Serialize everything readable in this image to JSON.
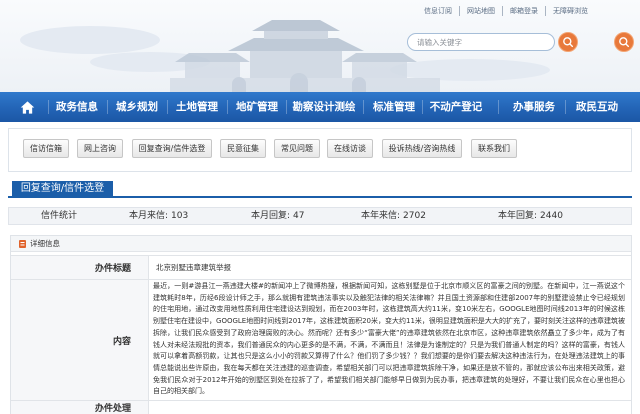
{
  "top_links": [
    {
      "label": "信息订阅"
    },
    {
      "label": "网站地图"
    },
    {
      "label": "邮箱登录"
    },
    {
      "label": "无障碍浏览"
    }
  ],
  "search": {
    "placeholder": "请输入关键字"
  },
  "nav": {
    "items": [
      {
        "label": "政务信息"
      },
      {
        "label": "城乡规划"
      },
      {
        "label": "土地管理"
      },
      {
        "label": "地矿管理"
      },
      {
        "label": "勘察设计测绘"
      },
      {
        "label": "标准管理"
      },
      {
        "label": "不动产登记"
      },
      {
        "label": "办事服务"
      },
      {
        "label": "政民互动"
      }
    ]
  },
  "quick_links": [
    {
      "label": "信访信箱"
    },
    {
      "label": "网上咨询"
    },
    {
      "label": "回复查询/信件选登"
    },
    {
      "label": "民意征集"
    },
    {
      "label": "常见问题"
    },
    {
      "label": "在线访谈"
    },
    {
      "label": "投诉热线/咨询热线"
    },
    {
      "label": "联系我们"
    }
  ],
  "section_tab": {
    "label": "回复查询/信件选登"
  },
  "stats": {
    "title": "信件统计",
    "items": [
      {
        "label": "本月来信:",
        "value": 103
      },
      {
        "label": "本月回复:",
        "value": 47
      },
      {
        "label": "本年来信:",
        "value": 2702
      },
      {
        "label": "本年回复:",
        "value": 2440
      }
    ]
  },
  "detail": {
    "header": "详细信息",
    "rows": [
      {
        "label": "办件标题",
        "value": "北京别墅违章建筑举报"
      },
      {
        "label": "内容",
        "value": "最近，一则#游县江一燕违建大楼#的新闻冲上了微博热搜，根据新闻可知，这栋别墅是位于北京市顺义区的富豪之间的别墅。在新闻中，江一燕说这个建筑耗时8年，历经6段设计师之手，那么就拥有建筑违法事实以及触犯法律的相关法律嘛？并且国土资源部和住建部2007年的别墅建设禁止令已经规划的住宅用地，通过改变用地性质利用住宅建设达到规划，而在2003年时，这栋建筑高大约11米，变10米左右，GOOGLE地图时间线2013年的时候这栋别墅住宅在建设中，GOOGLE地图时间线到2017年，这栋建筑面积20米，变大约11米，很明显建筑面积是大大的扩充了，要时刻关注这样的违章建筑被拆除，让我们民众感受到了政府治理腐败的决心。然而呢？还有多少“富豪大佬”的违章建筑依然在北京市区，这种违章建筑依然矗立了多少年，成为了有钱人对未经法规批的资本，我们普通民众的内心更多的是不满，不满，不满而且！法律是为谁制定的？只是为我们普通人制定的吗？这样的富豪，有钱人就可以拿着高额罚款，让其也只是这么小小的罚款又算得了什么？他们罚了多少钱？？我们想要的是你们要去解决这种违法行为，在处理违法建筑上的事情总能说出些许原由，我在每天都在关注违建的巡查调查，希望相关部门可以把违章建筑拆除干净，如果还是放不管的，那就应该公布出来相关政策，避免我们民众对于2012年开始的别墅区到处在拉拆了了，希望我们相关部门能够早日做到为民办事，把违章建筑的处理好，不要让我们民众在心里也担心自己的相关部门。"
      },
      {
        "label": "办件处理"
      }
    ]
  },
  "icons": {
    "home": "home-icon",
    "search": "search-icon",
    "detail": "document-icon"
  },
  "colors": {
    "nav_blue": "#1e62b4",
    "tab_blue": "#1b5ea9",
    "accent_orange": "#e8793b"
  }
}
